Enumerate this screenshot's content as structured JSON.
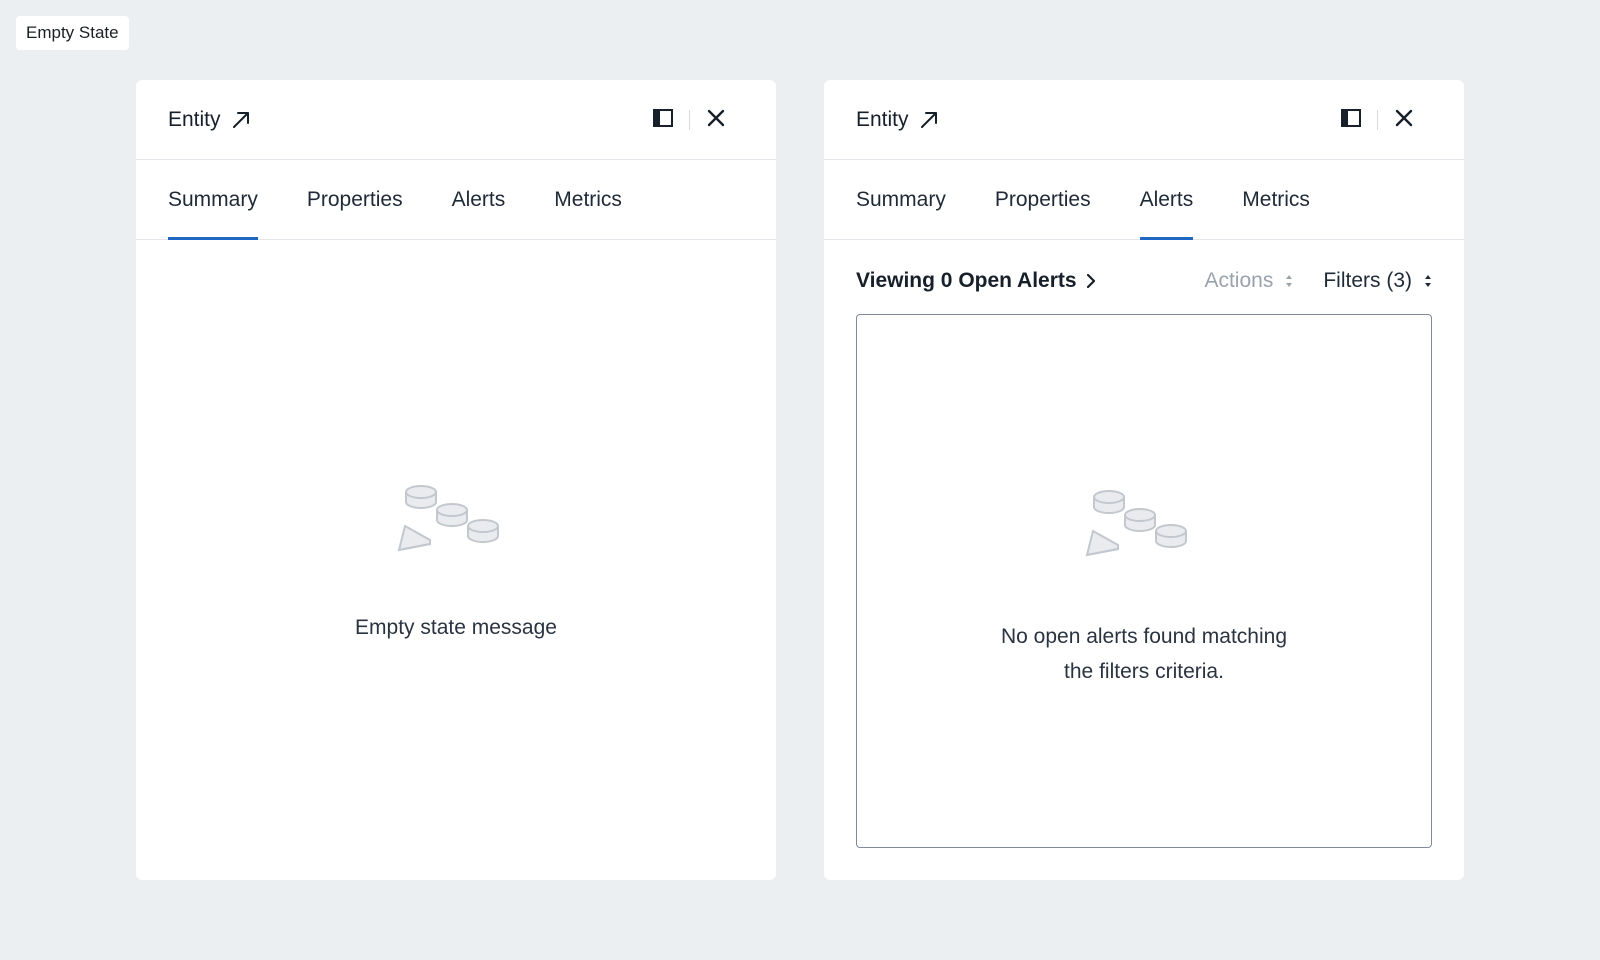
{
  "page_label": "Empty State",
  "colors": {
    "background": "#ebeff2",
    "panel": "#ffffff",
    "tab_indicator": "#1f67c3",
    "muted_text": "#9aa3ad"
  },
  "icons": {
    "external_link": "arrow-up-right-icon",
    "dock": "panel-dock-icon",
    "close": "close-icon",
    "chevron": "chevron-right-icon",
    "sort": "sort-updown-icon",
    "empty_illustration": "empty-shapes-illustration"
  },
  "left_panel": {
    "title": "Entity",
    "tabs": [
      {
        "label": "Summary",
        "active": true
      },
      {
        "label": "Properties",
        "active": false
      },
      {
        "label": "Alerts",
        "active": false
      },
      {
        "label": "Metrics",
        "active": false
      }
    ],
    "empty_message": "Empty state message"
  },
  "right_panel": {
    "title": "Entity",
    "tabs": [
      {
        "label": "Summary",
        "active": false
      },
      {
        "label": "Properties",
        "active": false
      },
      {
        "label": "Alerts",
        "active": true
      },
      {
        "label": "Metrics",
        "active": false
      }
    ],
    "viewing_label": "Viewing 0 Open Alerts",
    "actions_label": "Actions",
    "filters_label": "Filters (3)",
    "empty_message_line1": "No open alerts found matching",
    "empty_message_line2": "the filters criteria."
  }
}
